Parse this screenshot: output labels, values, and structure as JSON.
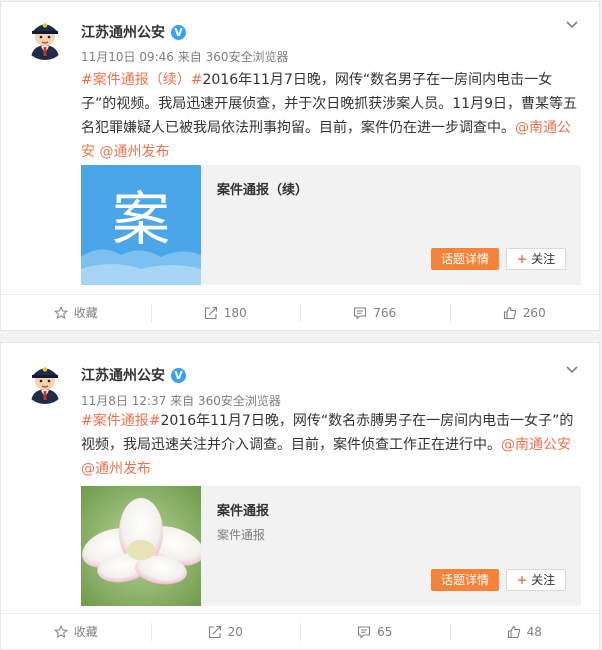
{
  "posts": [
    {
      "author": "江苏通州公安",
      "verified_mark": "V",
      "meta": "11月10日 09:46 来自 360安全浏览器",
      "body": {
        "hashtag": "#案件通报（续）#",
        "text": "2016年11月7日晚，网传“数名男子在一房间内电击一女子”的视频。我局迅速开展侦查，并于次日晚抓获涉案人员。11月9日，曹某等五名犯罪嫌疑人已被我局依法刑事拘留。目前，案件仍在进一步调查中。",
        "mention1": "@南通公安",
        "mention2": "@通州发布"
      },
      "share": {
        "thumb_char": "案",
        "title": "案件通报（续）",
        "desc": "",
        "topic_btn": "话题详情",
        "follow_btn": "关注"
      },
      "actions": {
        "fav": "收藏",
        "repost": "180",
        "comment": "766",
        "like": "260"
      }
    },
    {
      "author": "江苏通州公安",
      "verified_mark": "V",
      "meta": "11月8日 12:37 来自 360安全浏览器",
      "body": {
        "hashtag": "#案件通报#",
        "text": "2016年11月7日晚，网传“数名赤膊男子在一房间内电击一女子”的视频，我局迅速关注并介入调查。目前，案件侦查工作正在进行中。",
        "mention1": "@南通公安",
        "mention2": "@通州发布"
      },
      "share": {
        "thumb_char": "",
        "title": "案件通报",
        "desc": "案件通报",
        "topic_btn": "话题详情",
        "follow_btn": "关注"
      },
      "actions": {
        "fav": "收藏",
        "repost": "20",
        "comment": "65",
        "like": "48"
      }
    }
  ],
  "colors": {
    "link": "#eb7350",
    "topic_btn": "#f5843a",
    "verified": "#3aa0f2",
    "thumb_blue": "#4aa6e8"
  }
}
